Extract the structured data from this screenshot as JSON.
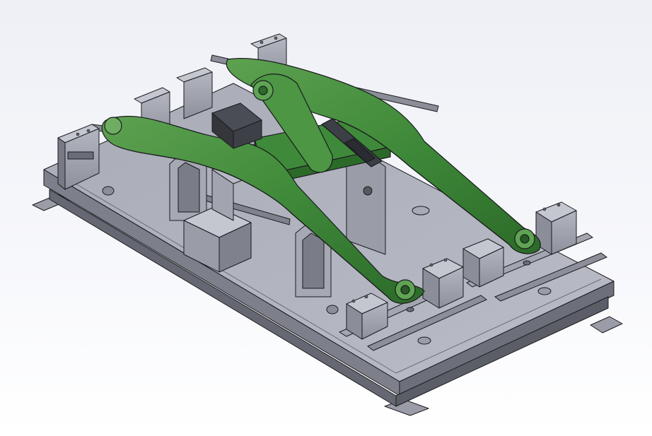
{
  "viewport": {
    "background_top": "#eef0f6",
    "background_bottom": "#ffffff"
  },
  "model": {
    "base_plate_color": "#8b8e99",
    "base_plate_top_color": "#b7bac4",
    "fixture_color": "#9ea1ab",
    "fixture_dark_color": "#5c5f68",
    "arm_color": "#3f8a3a",
    "arm_shadow_color": "#285c26",
    "arm_highlight_color": "#6fae62",
    "edge_color": "#1b1b1f"
  }
}
